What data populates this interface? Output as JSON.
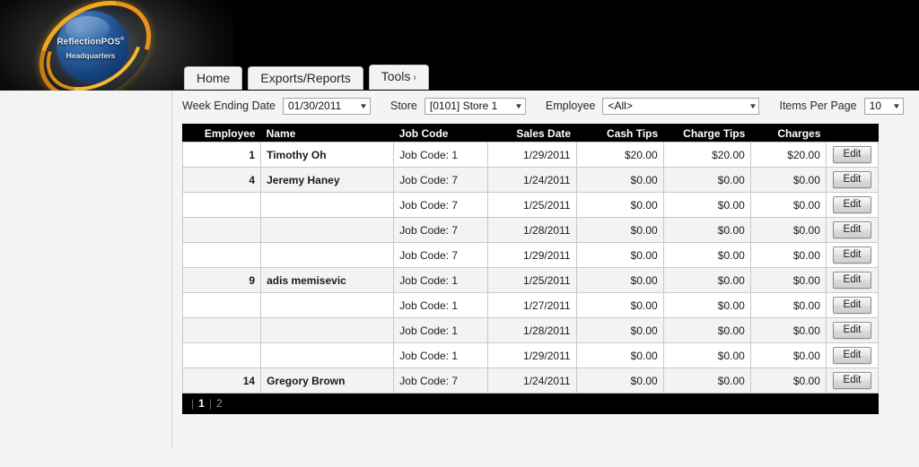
{
  "brand": {
    "name": "ReflectionPOS",
    "trademark": "®",
    "subtitle": "Headquarters"
  },
  "nav": {
    "tabs": [
      {
        "label": "Home",
        "caret": ""
      },
      {
        "label": "Exports/Reports",
        "caret": ""
      },
      {
        "label": "Tools",
        "caret": "›"
      }
    ]
  },
  "filters": {
    "week_ending_label": "Week Ending Date",
    "week_ending_value": "01/30/2011",
    "store_label": "Store",
    "store_value": "[0101] Store 1",
    "employee_label": "Employee",
    "employee_value": "<All>",
    "items_per_page_label": "Items Per Page",
    "items_per_page_value": "10",
    "arrow": "▼"
  },
  "table": {
    "columns": [
      {
        "key": "employee",
        "label": "Employee",
        "align": "right"
      },
      {
        "key": "name",
        "label": "Name",
        "align": "left"
      },
      {
        "key": "job_code",
        "label": "Job Code",
        "align": "left"
      },
      {
        "key": "sales_date",
        "label": "Sales Date",
        "align": "right"
      },
      {
        "key": "cash_tips",
        "label": "Cash Tips",
        "align": "right"
      },
      {
        "key": "charge_tips",
        "label": "Charge Tips",
        "align": "right"
      },
      {
        "key": "charges",
        "label": "Charges",
        "align": "right"
      },
      {
        "key": "action",
        "label": "",
        "align": "center"
      }
    ],
    "edit_label": "Edit",
    "rows": [
      {
        "employee": "1",
        "name": "Timothy Oh",
        "job_code": "Job Code: 1",
        "sales_date": "1/29/2011",
        "cash_tips": "$20.00",
        "charge_tips": "$20.00",
        "charges": "$20.00"
      },
      {
        "employee": "4",
        "name": "Jeremy Haney",
        "job_code": "Job Code: 7",
        "sales_date": "1/24/2011",
        "cash_tips": "$0.00",
        "charge_tips": "$0.00",
        "charges": "$0.00"
      },
      {
        "employee": "",
        "name": "",
        "job_code": "Job Code: 7",
        "sales_date": "1/25/2011",
        "cash_tips": "$0.00",
        "charge_tips": "$0.00",
        "charges": "$0.00"
      },
      {
        "employee": "",
        "name": "",
        "job_code": "Job Code: 7",
        "sales_date": "1/28/2011",
        "cash_tips": "$0.00",
        "charge_tips": "$0.00",
        "charges": "$0.00"
      },
      {
        "employee": "",
        "name": "",
        "job_code": "Job Code: 7",
        "sales_date": "1/29/2011",
        "cash_tips": "$0.00",
        "charge_tips": "$0.00",
        "charges": "$0.00"
      },
      {
        "employee": "9",
        "name": "adis memisevic",
        "job_code": "Job Code: 1",
        "sales_date": "1/25/2011",
        "cash_tips": "$0.00",
        "charge_tips": "$0.00",
        "charges": "$0.00"
      },
      {
        "employee": "",
        "name": "",
        "job_code": "Job Code: 1",
        "sales_date": "1/27/2011",
        "cash_tips": "$0.00",
        "charge_tips": "$0.00",
        "charges": "$0.00"
      },
      {
        "employee": "",
        "name": "",
        "job_code": "Job Code: 1",
        "sales_date": "1/28/2011",
        "cash_tips": "$0.00",
        "charge_tips": "$0.00",
        "charges": "$0.00"
      },
      {
        "employee": "",
        "name": "",
        "job_code": "Job Code: 1",
        "sales_date": "1/29/2011",
        "cash_tips": "$0.00",
        "charge_tips": "$0.00",
        "charges": "$0.00"
      },
      {
        "employee": "14",
        "name": "Gregory Brown",
        "job_code": "Job Code: 7",
        "sales_date": "1/24/2011",
        "cash_tips": "$0.00",
        "charge_tips": "$0.00",
        "charges": "$0.00"
      }
    ]
  },
  "pager": {
    "lead_separator": "|",
    "separator": "|",
    "pages": [
      {
        "label": "1",
        "current": true
      },
      {
        "label": "2",
        "current": false
      }
    ]
  },
  "colors": {
    "header_bg": "#000000",
    "alt_row": "#f3f3f3",
    "accent_gold": "#f0a81c",
    "sphere_blue": "#2c63a4"
  }
}
